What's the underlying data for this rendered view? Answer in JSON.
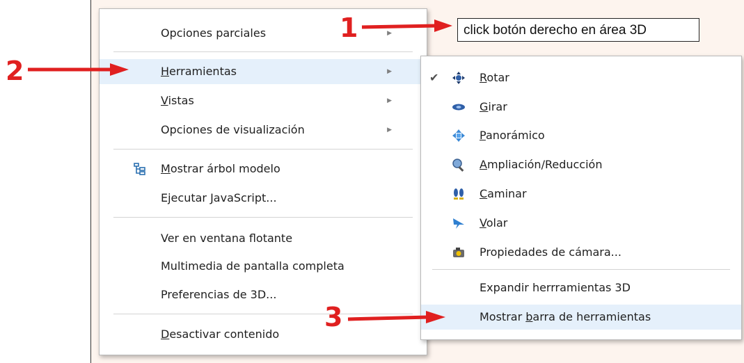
{
  "callout": {
    "text": "click botón derecho en área 3D",
    "step1": "1",
    "step2": "2",
    "step3": "3"
  },
  "main_menu": {
    "items": [
      {
        "label_pre": "Opciones parciales",
        "label_u": "",
        "label_post": "",
        "submenu": true
      },
      {
        "label_pre": "",
        "label_u": "H",
        "label_post": "erramientas",
        "submenu": true
      },
      {
        "label_pre": "",
        "label_u": "V",
        "label_post": "istas",
        "submenu": true
      },
      {
        "label_pre": "Opciones de visualización",
        "label_u": "",
        "label_post": "",
        "submenu": true
      },
      {
        "label_pre": "",
        "label_u": "M",
        "label_post": "ostrar árbol modelo",
        "icon": "model-tree-icon"
      },
      {
        "label_pre": "Ejecutar ",
        "label_u": "J",
        "label_post": "avaScript..."
      },
      {
        "label_pre": "Ver en ventana flotante",
        "label_u": "",
        "label_post": ""
      },
      {
        "label_pre": "Multimedia de pantalla completa",
        "label_u": "",
        "label_post": ""
      },
      {
        "label_pre": "Preferencias de 3D...",
        "label_u": "",
        "label_post": ""
      },
      {
        "label_pre": "",
        "label_u": "D",
        "label_post": "esactivar contenido"
      }
    ]
  },
  "sub_menu": {
    "items": [
      {
        "label_pre": "",
        "label_u": "R",
        "label_post": "otar",
        "icon": "rotate-icon",
        "checked": true
      },
      {
        "label_pre": "",
        "label_u": "G",
        "label_post": "irar",
        "icon": "spin-icon"
      },
      {
        "label_pre": "",
        "label_u": "P",
        "label_post": "anorámico",
        "icon": "pan-icon"
      },
      {
        "label_pre": "",
        "label_u": "A",
        "label_post": "mpliación/Reducción",
        "icon": "zoom-icon"
      },
      {
        "label_pre": "",
        "label_u": "C",
        "label_post": "aminar",
        "icon": "walk-icon"
      },
      {
        "label_pre": "",
        "label_u": "V",
        "label_post": "olar",
        "icon": "fly-icon"
      },
      {
        "label_pre": "Propiedades de cámara...",
        "label_u": "",
        "label_post": "",
        "icon": "camera-icon"
      },
      {
        "label_pre": "Expandir herrramientas 3D",
        "label_u": "",
        "label_post": ""
      },
      {
        "label_pre": "Mostrar ",
        "label_u": "b",
        "label_post": "arra de herramientas"
      }
    ],
    "check_glyph": "✔",
    "arrow_glyph": "▶"
  },
  "colors": {
    "annotation_red": "#e02020",
    "highlight": "#e5f0fb",
    "background_3d": "#fdf4ee"
  }
}
